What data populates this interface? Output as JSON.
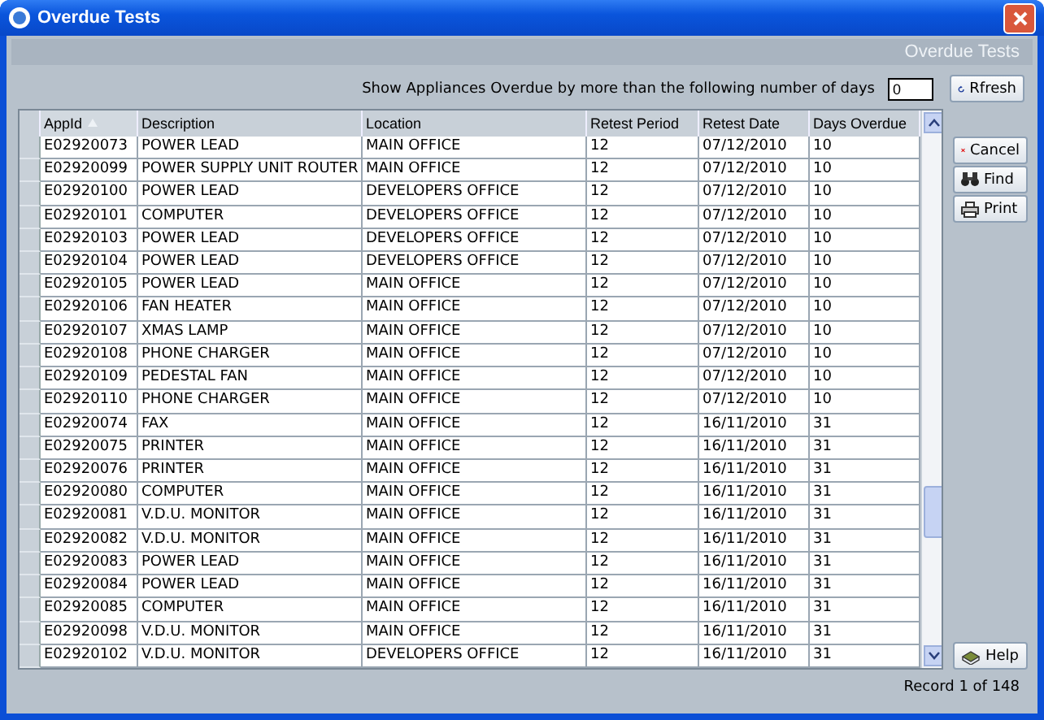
{
  "window": {
    "title": "Overdue Tests"
  },
  "banner": {
    "title": "Overdue Tests"
  },
  "filter": {
    "label": "Show Appliances Overdue by more than the following number of days",
    "value": "0"
  },
  "refresh_button": {
    "label": "Rfresh"
  },
  "table": {
    "columns": [
      {
        "label": "AppId",
        "sorted": true
      },
      {
        "label": "Description",
        "sorted": false
      },
      {
        "label": "Location",
        "sorted": false
      },
      {
        "label": "Retest Period",
        "sorted": false
      },
      {
        "label": "Retest Date",
        "sorted": false
      },
      {
        "label": "Days Overdue",
        "sorted": false
      }
    ],
    "rows": [
      [
        "E02920073",
        "POWER LEAD",
        "MAIN OFFICE",
        "12",
        "07/12/2010",
        "10"
      ],
      [
        "E02920099",
        "POWER SUPPLY UNIT ROUTER",
        "MAIN OFFICE",
        "12",
        "07/12/2010",
        "10"
      ],
      [
        "E02920100",
        "POWER LEAD",
        "DEVELOPERS OFFICE",
        "12",
        "07/12/2010",
        "10"
      ],
      [
        "E02920101",
        "COMPUTER",
        "DEVELOPERS OFFICE",
        "12",
        "07/12/2010",
        "10"
      ],
      [
        "E02920103",
        "POWER LEAD",
        "DEVELOPERS OFFICE",
        "12",
        "07/12/2010",
        "10"
      ],
      [
        "E02920104",
        "POWER LEAD",
        "DEVELOPERS OFFICE",
        "12",
        "07/12/2010",
        "10"
      ],
      [
        "E02920105",
        "POWER LEAD",
        "MAIN OFFICE",
        "12",
        "07/12/2010",
        "10"
      ],
      [
        "E02920106",
        "FAN HEATER",
        "MAIN OFFICE",
        "12",
        "07/12/2010",
        "10"
      ],
      [
        "E02920107",
        "XMAS LAMP",
        "MAIN OFFICE",
        "12",
        "07/12/2010",
        "10"
      ],
      [
        "E02920108",
        "PHONE CHARGER",
        "MAIN OFFICE",
        "12",
        "07/12/2010",
        "10"
      ],
      [
        "E02920109",
        "PEDESTAL FAN",
        "MAIN OFFICE",
        "12",
        "07/12/2010",
        "10"
      ],
      [
        "E02920110",
        "PHONE CHARGER",
        "MAIN OFFICE",
        "12",
        "07/12/2010",
        "10"
      ],
      [
        "E02920074",
        "FAX",
        "MAIN OFFICE",
        "12",
        "16/11/2010",
        "31"
      ],
      [
        "E02920075",
        "PRINTER",
        "MAIN OFFICE",
        "12",
        "16/11/2010",
        "31"
      ],
      [
        "E02920076",
        "PRINTER",
        "MAIN OFFICE",
        "12",
        "16/11/2010",
        "31"
      ],
      [
        "E02920080",
        "COMPUTER",
        "MAIN OFFICE",
        "12",
        "16/11/2010",
        "31"
      ],
      [
        "E02920081",
        "V.D.U. MONITOR",
        "MAIN OFFICE",
        "12",
        "16/11/2010",
        "31"
      ],
      [
        "E02920082",
        "V.D.U. MONITOR",
        "MAIN OFFICE",
        "12",
        "16/11/2010",
        "31"
      ],
      [
        "E02920083",
        "POWER LEAD",
        "MAIN OFFICE",
        "12",
        "16/11/2010",
        "31"
      ],
      [
        "E02920084",
        "POWER LEAD",
        "MAIN OFFICE",
        "12",
        "16/11/2010",
        "31"
      ],
      [
        "E02920085",
        "COMPUTER",
        "MAIN OFFICE",
        "12",
        "16/11/2010",
        "31"
      ],
      [
        "E02920098",
        "V.D.U. MONITOR",
        "MAIN OFFICE",
        "12",
        "16/11/2010",
        "31"
      ],
      [
        "E02920102",
        "V.D.U. MONITOR",
        "DEVELOPERS OFFICE",
        "12",
        "16/11/2010",
        "31"
      ]
    ]
  },
  "side_buttons": [
    {
      "kind": "cancel",
      "label": "Cancel"
    },
    {
      "kind": "find",
      "label": "Find"
    },
    {
      "kind": "print",
      "label": "Print"
    }
  ],
  "help_button": {
    "label": "Help"
  },
  "status": {
    "record": "Record 1 of 148"
  }
}
